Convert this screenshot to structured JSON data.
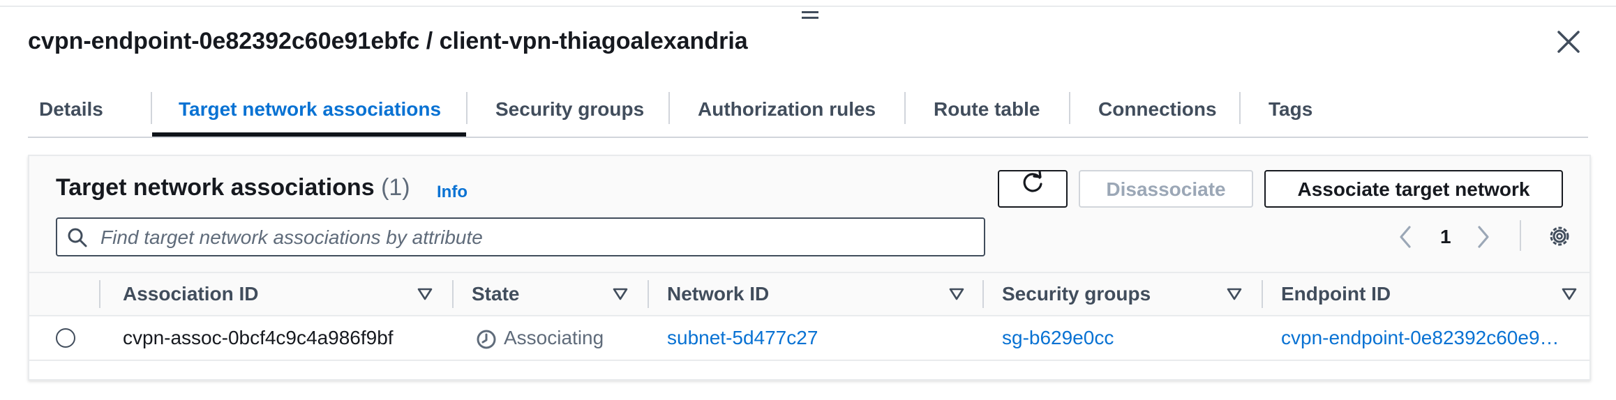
{
  "header": {
    "title": "cvpn-endpoint-0e82392c60e91ebfc / client-vpn-thiagoalexandria"
  },
  "tabs": [
    {
      "label": "Details"
    },
    {
      "label": "Target network associations",
      "active": true
    },
    {
      "label": "Security groups"
    },
    {
      "label": "Authorization rules"
    },
    {
      "label": "Route table"
    },
    {
      "label": "Connections"
    },
    {
      "label": "Tags"
    }
  ],
  "panel": {
    "title": "Target network associations",
    "count": "(1)",
    "info_label": "Info",
    "disassociate_label": "Disassociate",
    "associate_label": "Associate target network",
    "search_placeholder": "Find target network associations by attribute",
    "page_number": "1"
  },
  "table": {
    "columns": [
      "Association ID",
      "State",
      "Network ID",
      "Security groups",
      "Endpoint ID"
    ],
    "rows": [
      {
        "association_id": "cvpn-assoc-0bcf4c9c4a986f9bf",
        "state": "Associating",
        "network_id": "subnet-5d477c27",
        "security_groups": "sg-b629e0cc",
        "endpoint_id": "cvpn-endpoint-0e82392c60e9…"
      }
    ]
  },
  "colors": {
    "link": "#0972d3",
    "text": "#16191f",
    "muted": "#5f6b7a",
    "disabled": "#9ba7b6",
    "divider": "#e9ebed"
  },
  "icons": [
    "resize-handle-icon",
    "close-icon",
    "refresh-icon",
    "search-icon",
    "chevron-left-icon",
    "chevron-right-icon",
    "gear-icon",
    "sort-caret-icon",
    "clock-icon",
    "radio-icon"
  ]
}
